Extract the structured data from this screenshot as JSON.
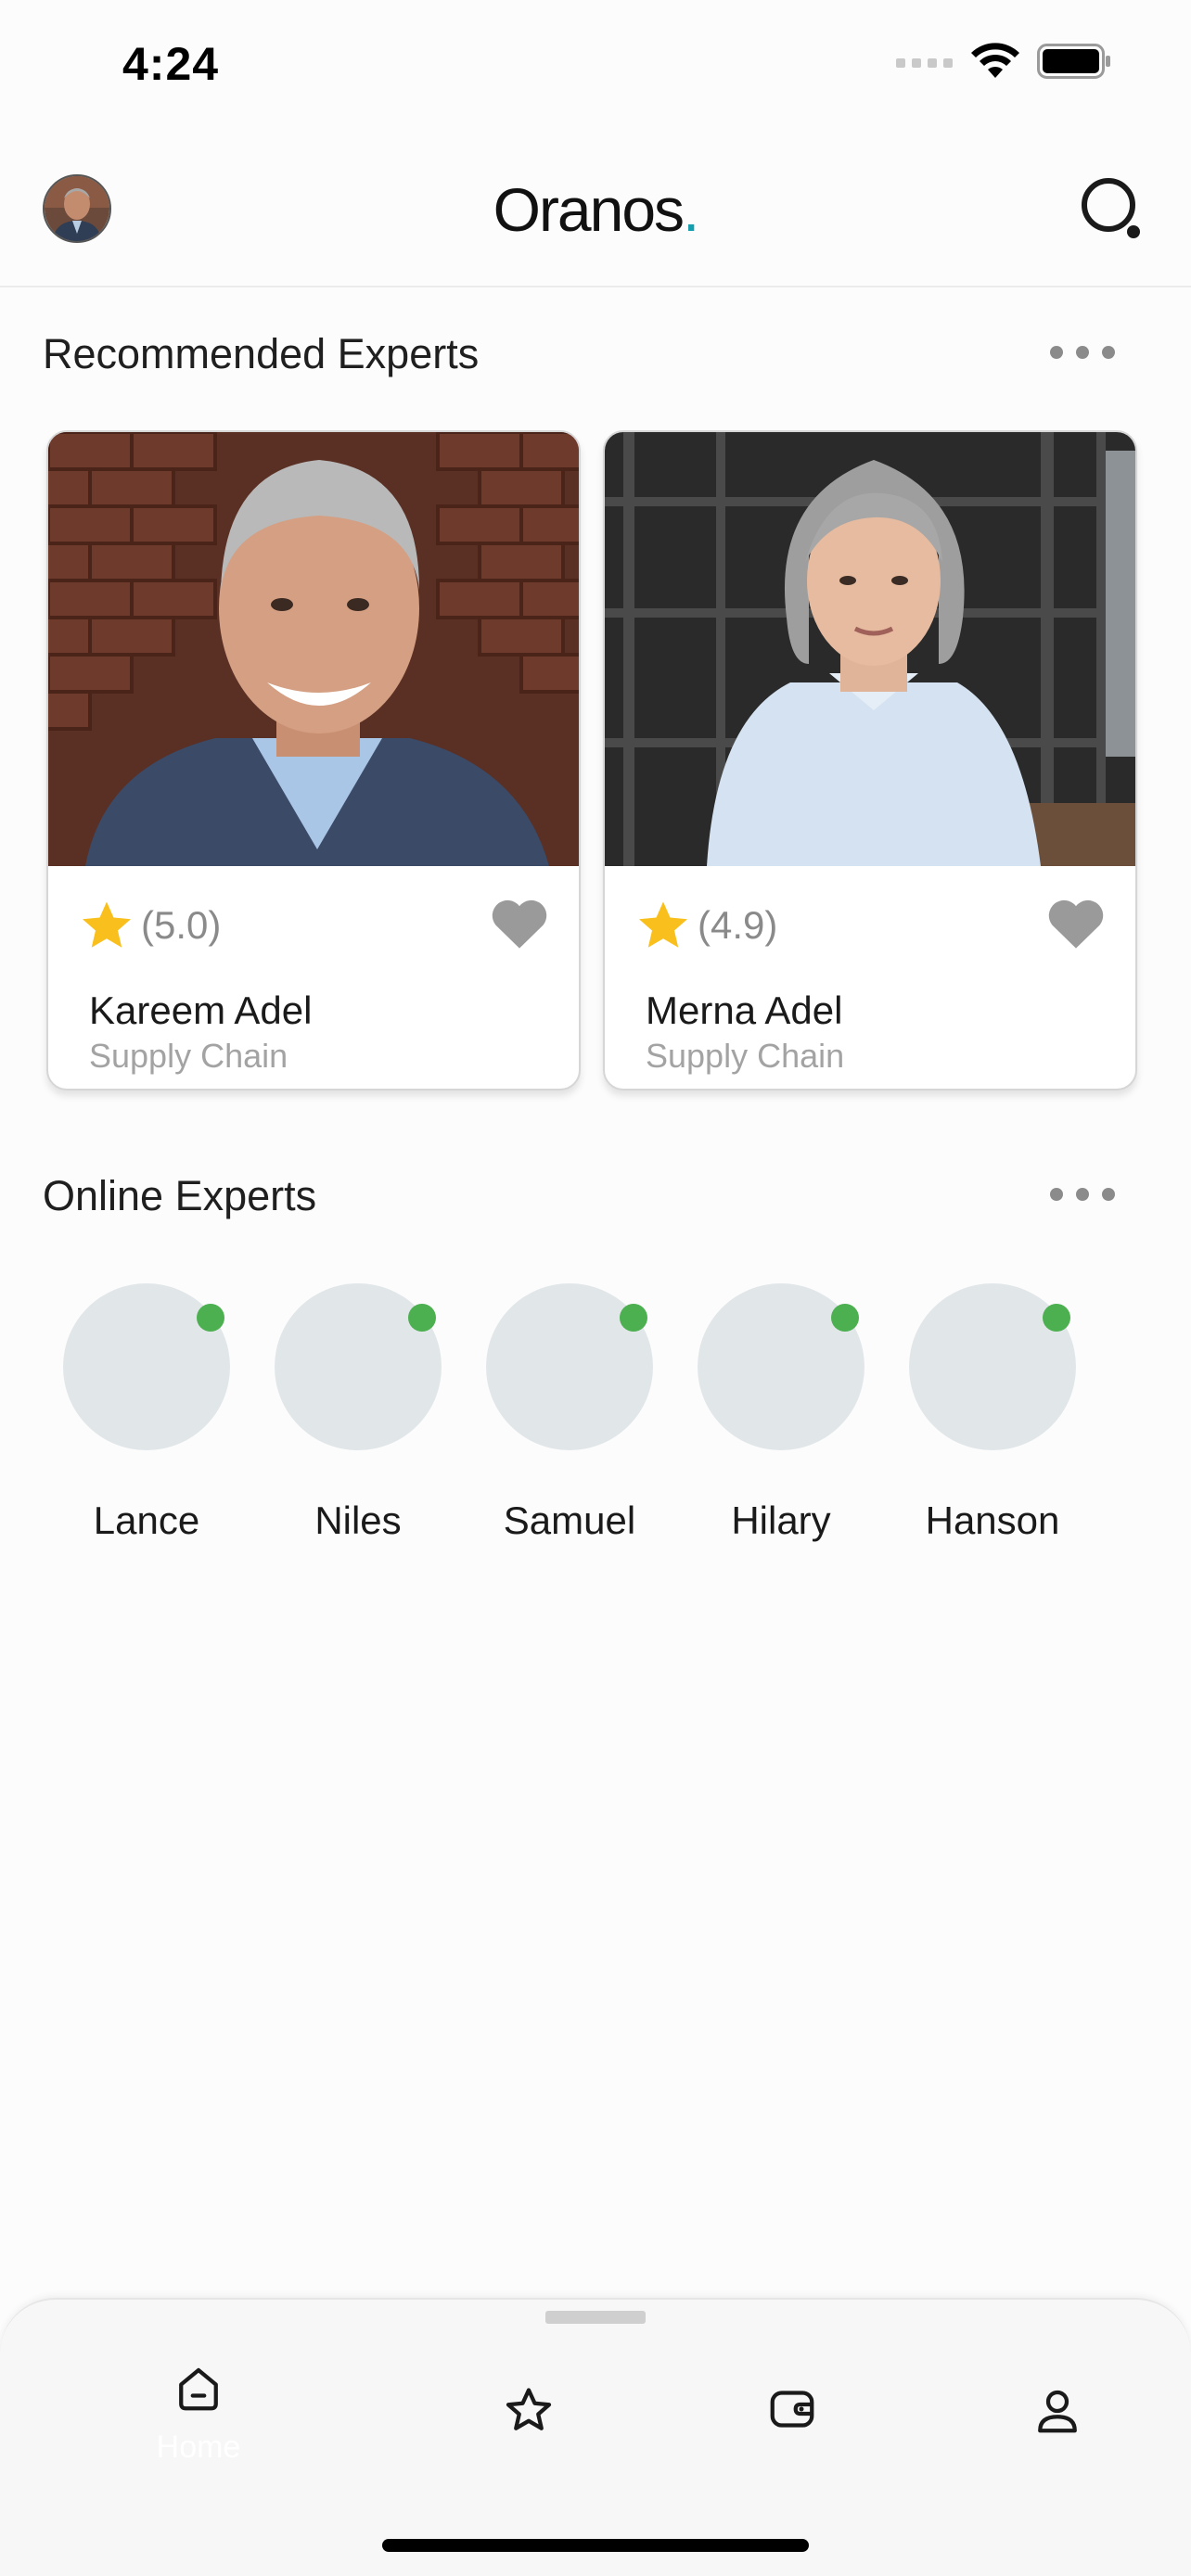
{
  "status_bar": {
    "time": "4:24"
  },
  "header": {
    "logo_text": "Oranos",
    "logo_dot": ".",
    "accent_color": "#159fae"
  },
  "recommended": {
    "title": "Recommended Experts",
    "experts": [
      {
        "rating": "(5.0)",
        "name": "Kareem Adel",
        "role": "Supply Chain"
      },
      {
        "rating": "(4.9)",
        "name": "Merna Adel",
        "role": "Supply Chain"
      }
    ]
  },
  "online": {
    "title": "Online Experts",
    "status_color": "#4caf50",
    "experts": [
      {
        "name": "Lance"
      },
      {
        "name": "Niles"
      },
      {
        "name": "Samuel"
      },
      {
        "name": "Hilary"
      },
      {
        "name": "Hanson"
      }
    ]
  },
  "tab_bar": {
    "tabs": [
      {
        "label": "Home",
        "icon": "home-icon"
      },
      {
        "label": "",
        "icon": "star-icon"
      },
      {
        "label": "",
        "icon": "wallet-icon"
      },
      {
        "label": "",
        "icon": "profile-icon"
      }
    ]
  }
}
